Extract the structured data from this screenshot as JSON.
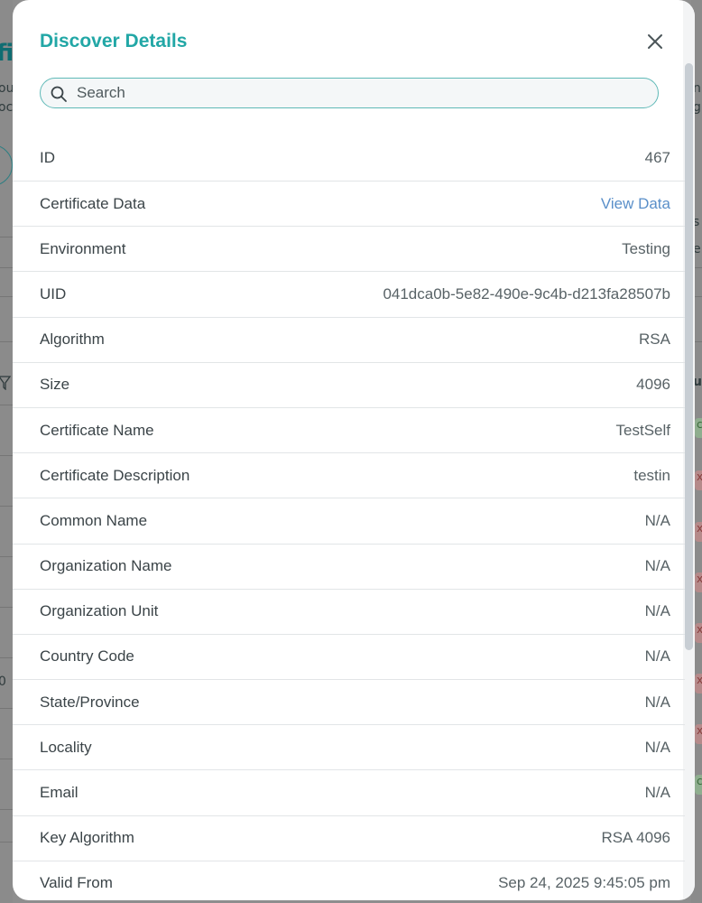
{
  "modal": {
    "title": "Discover Details",
    "search_placeholder": "Search"
  },
  "details": [
    {
      "label": "ID",
      "value": "467"
    },
    {
      "label": "Certificate Data",
      "value": "View Data",
      "link": true
    },
    {
      "label": "Environment",
      "value": "Testing"
    },
    {
      "label": "UID",
      "value": "041dca0b-5e82-490e-9c4b-d213fa28507b"
    },
    {
      "label": "Algorithm",
      "value": "RSA"
    },
    {
      "label": "Size",
      "value": "4096"
    },
    {
      "label": "Certificate Name",
      "value": "TestSelf"
    },
    {
      "label": "Certificate Description",
      "value": "testin"
    },
    {
      "label": "Common Name",
      "value": "N/A"
    },
    {
      "label": "Organization Name",
      "value": "N/A"
    },
    {
      "label": "Organization Unit",
      "value": "N/A"
    },
    {
      "label": "Country Code",
      "value": "N/A"
    },
    {
      "label": "State/Province",
      "value": "N/A"
    },
    {
      "label": "Locality",
      "value": "N/A"
    },
    {
      "label": "Email",
      "value": "N/A"
    },
    {
      "label": "Key Algorithm",
      "value": "RSA 4096"
    },
    {
      "label": "Valid From",
      "value": "Sep 24, 2025 9:45:05 pm"
    }
  ],
  "background": {
    "title_fragment": "fi",
    "left_text": [
      "ou",
      "oc"
    ],
    "right_text": [
      "n",
      "g",
      "s",
      "e",
      "u"
    ],
    "left_number": "0",
    "status_pill_red": "x",
    "status_pill_green": "c"
  },
  "colors": {
    "accent": "#22a7a6",
    "link": "#5a8fc9",
    "search_border": "#5fb9b7"
  }
}
